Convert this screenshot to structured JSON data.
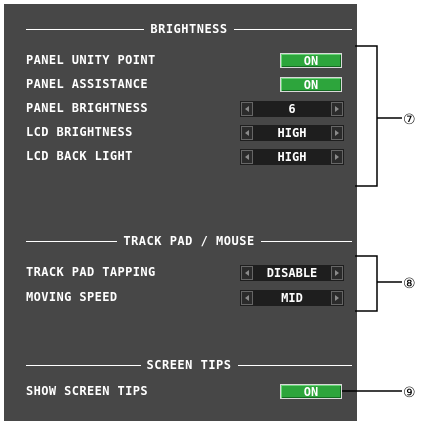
{
  "sections": {
    "brightness": {
      "title": "BRIGHTNESS",
      "rows": [
        {
          "label": "PANEL UNITY POINT",
          "control": "toggle",
          "value": "ON"
        },
        {
          "label": "PANEL ASSISTANCE",
          "control": "toggle",
          "value": "ON"
        },
        {
          "label": "PANEL BRIGHTNESS",
          "control": "spinner",
          "value": "6"
        },
        {
          "label": "LCD BRIGHTNESS",
          "control": "spinner",
          "value": "HIGH"
        },
        {
          "label": "LCD BACK LIGHT",
          "control": "spinner",
          "value": "HIGH"
        }
      ]
    },
    "trackpad": {
      "title": "TRACK PAD / MOUSE",
      "rows": [
        {
          "label": "TRACK PAD TAPPING",
          "control": "spinner",
          "value": "DISABLE"
        },
        {
          "label": "MOVING SPEED",
          "control": "spinner",
          "value": "MID"
        }
      ]
    },
    "screentips": {
      "title": "SCREEN TIPS",
      "rows": [
        {
          "label": "SHOW SCREEN TIPS",
          "control": "toggle",
          "value": "ON"
        }
      ]
    }
  },
  "callouts": {
    "brightness": "⑦",
    "trackpad": "⑧",
    "screentips": "⑨"
  },
  "colors": {
    "panel_bg": "#474747",
    "toggle_on": "#2da53c",
    "spinner_bg": "#1e1e1e",
    "text": "#ffffff"
  }
}
